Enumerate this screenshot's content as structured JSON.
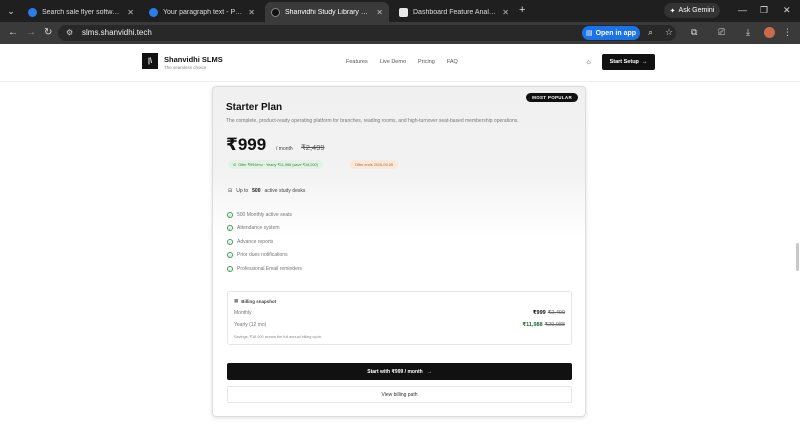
{
  "browser": {
    "tabs": [
      {
        "title": "Search sale flyer software - Canva",
        "fav_color": "#2b7de9",
        "active": false
      },
      {
        "title": "Your paragraph text - Poster",
        "fav_color": "#2b7de9",
        "active": false
      },
      {
        "title": "Shanvidhi Study Library — Mock",
        "fav_color": "#111111",
        "active": true
      },
      {
        "title": "Dashboard Feature Analysis",
        "fav_color": "#e8e8e8",
        "active": false
      }
    ],
    "new_tab": "+",
    "gemini_label": "Ask Gemini",
    "url": "slms.shanvidhi.tech",
    "open_in_app": "Open in app"
  },
  "site": {
    "logo_text": "|\\",
    "brand": "Shanvidhi SLMS",
    "tagline": "The seamless choice",
    "nav": [
      "Features",
      "Live Demo",
      "Pricing",
      "FAQ"
    ],
    "start_setup": "Start Setup"
  },
  "plan": {
    "badge": "MOST POPULAR",
    "name": "Starter Plan",
    "description": "The complete, product-ready operating platform for branches, reading rooms, and high-turnover seat-based membership operations.",
    "price": "₹999",
    "per": "/ month",
    "old_price": "₹2,499",
    "offer": "Offer ₹999/mo · Yearly ₹11,988 (save ₹18,000)",
    "offer_ends": "Offer ends 2026-09-05",
    "desks_prefix": "Up to",
    "desks_count": "500",
    "desks_suffix": "active study desks",
    "features": [
      "500 Monthly active seats",
      "Attendance system",
      "Advance reports",
      "Prior dues notifications",
      "Professional Email reminders"
    ],
    "billing": {
      "title": "Billing snapshot",
      "monthly_label": "Monthly",
      "monthly_price": "₹999",
      "monthly_old": "₹2,499",
      "yearly_label": "Yearly (12 mo)",
      "yearly_price": "₹11,988",
      "yearly_old": "₹29,988",
      "savings": "Savings: ₹18,000 across the full annual billing cycle."
    },
    "cta": "Start with ₹999 / month",
    "secondary": "View billing path"
  },
  "colors": {
    "accent_dark": "#111111",
    "offer_green": "#e2f3e5",
    "offer_orange": "#fbe8d8",
    "check_green": "#3d9a5b"
  }
}
